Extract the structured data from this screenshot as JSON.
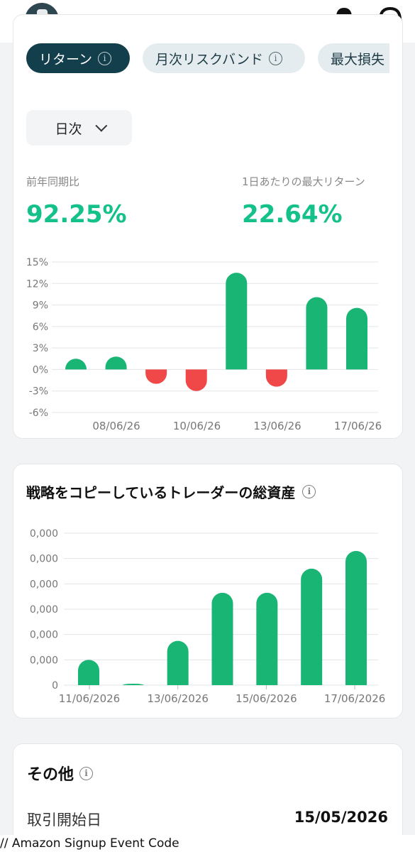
{
  "header": {
    "avatar_icon": "robot-avatar",
    "notification_icon": "bell-icon",
    "support_icon": "headset-icon"
  },
  "tabs": [
    {
      "label": "リターン",
      "active": true
    },
    {
      "label": "月次リスクバンド",
      "active": false
    },
    {
      "label": "最大損失",
      "active": false
    }
  ],
  "period": {
    "selected": "日次"
  },
  "stats": {
    "yoy_label": "前年同期比",
    "yoy_value": "92.25%",
    "max_daily_label": "1日あたりの最大リターン",
    "max_daily_value": "22.64%"
  },
  "copy_section": {
    "title": "戦略をコピーしているトレーダーの総資産"
  },
  "other": {
    "title": "その他",
    "start_label": "取引開始日",
    "start_value": "15/05/2026"
  },
  "footer": {
    "text": "// Amazon Signup Event Code"
  },
  "colors": {
    "positive": "#19b574",
    "negative": "#f04848",
    "accent": "#15c18a",
    "tab_active": "#123f4b"
  },
  "chart_data": [
    {
      "type": "bar",
      "y_tick_labels": [
        "15%",
        "12%",
        "9%",
        "6%",
        "3%",
        "0%",
        "-3%",
        "-6%"
      ],
      "x_tick_labels": [
        "08/06/26",
        "10/06/26",
        "13/06/26",
        "17/06/26"
      ],
      "ylim": [
        -6,
        15
      ],
      "values": [
        1.5,
        1.8,
        -2.0,
        -3.0,
        13.5,
        -2.4,
        10.1,
        8.6
      ],
      "grid": true
    },
    {
      "type": "bar",
      "y_tick_labels": [
        "0,000",
        "0,000",
        "0,000",
        "0,000",
        "0,000",
        "0,000",
        "0"
      ],
      "x_tick_labels": [
        "11/06/2026",
        "13/06/2026",
        "15/06/2026",
        "17/06/2026"
      ],
      "ylim": [
        0,
        6
      ],
      "values": [
        1.0,
        0.05,
        1.75,
        3.65,
        3.65,
        4.6,
        5.3
      ],
      "grid": true
    }
  ]
}
